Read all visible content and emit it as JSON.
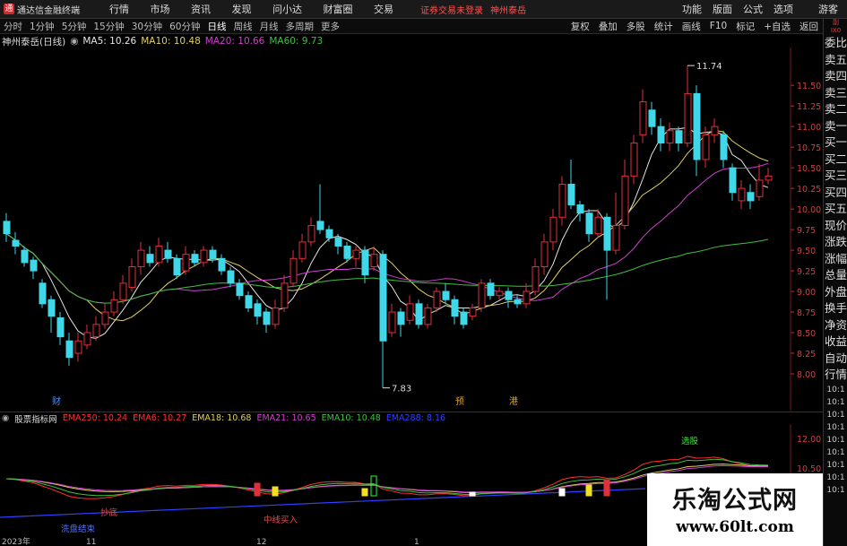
{
  "app": {
    "logo_char": "通",
    "title": "通达信金融终端"
  },
  "menu": [
    "行情",
    "市场",
    "资讯",
    "发现",
    "问小达",
    "财富圈",
    "交易"
  ],
  "notice": "证券交易未登录",
  "stock_tag": "神州泰岳",
  "top_right": [
    "功能",
    "版面",
    "公式",
    "选项"
  ],
  "guest": "游客",
  "periods": [
    "分时",
    "1分钟",
    "5分钟",
    "15分钟",
    "30分钟",
    "60分钟",
    "日线",
    "周线",
    "月线",
    "多周期",
    "更多"
  ],
  "active_period": "日线",
  "period_tools": [
    "复权",
    "叠加",
    "多股",
    "统计",
    "画线",
    "F10",
    "标记",
    "+自选",
    "返回"
  ],
  "stock_label": "神州泰岳(日线)",
  "ma": [
    {
      "label": "MA5: 10.26",
      "color": "#e6e6e6"
    },
    {
      "label": "MA10: 10.48",
      "color": "#e0d060"
    },
    {
      "label": "MA20: 10.66",
      "color": "#d040d0"
    },
    {
      "label": "MA60: 9.73",
      "color": "#40c040"
    }
  ],
  "right_panel": {
    "small": [
      "副",
      "IX0"
    ],
    "items": [
      "委比",
      "卖五",
      "卖四",
      "卖三",
      "卖二",
      "卖一",
      "买一",
      "买二",
      "买三",
      "买四",
      "买五",
      "现价",
      "涨跌",
      "涨幅",
      "总量",
      "外盘",
      "换手",
      "净资",
      "收益",
      "自动",
      "行情"
    ],
    "times": [
      "10:1",
      "10:1",
      "10:1",
      "10:1",
      "10:1",
      "10:1",
      "10:1",
      "10:1",
      "10:1"
    ]
  },
  "price_axis": [
    "11.50",
    "11.25",
    "11.00",
    "10.75",
    "10.50",
    "10.25",
    "10.00",
    "9.75",
    "9.50",
    "9.25",
    "9.00",
    "8.75",
    "8.50",
    "8.25",
    "8.00"
  ],
  "annotations": {
    "high": "11.74",
    "low": "7.83",
    "marker_cai": "财",
    "marker_yu": "预",
    "marker_gang": "港"
  },
  "indicator": {
    "name": "股票指标网",
    "items": [
      {
        "label": "EMA250: 10.24",
        "color": "#ff3030"
      },
      {
        "label": "EMA6: 10.27",
        "color": "#ff3030"
      },
      {
        "label": "EMA18: 10.68",
        "color": "#e0d060"
      },
      {
        "label": "EMA21: 10.65",
        "color": "#d040d0"
      },
      {
        "label": "EMA10: 10.48",
        "color": "#40c040"
      },
      {
        "label": "EMA288: 8.16",
        "color": "#3040ff"
      }
    ],
    "axis": [
      "12.00",
      "10.50"
    ],
    "labels": {
      "select": "选股",
      "bottom": "抄底",
      "mid_buy": "中线买入",
      "wash_end": "洗盘结束"
    }
  },
  "dates": [
    "2023年",
    "11",
    "12",
    "1"
  ],
  "watermark": {
    "title": "乐淘公式网",
    "url": "www.60lt.com"
  },
  "chart_data": {
    "type": "candlestick",
    "y_range": [
      7.75,
      11.85
    ],
    "candles": [
      [
        9.85,
        9.7,
        9.95,
        9.6
      ],
      [
        9.62,
        9.55,
        9.72,
        9.45
      ],
      [
        9.5,
        9.35,
        9.55,
        9.3
      ],
      [
        9.38,
        9.25,
        9.42,
        9.15
      ],
      [
        9.1,
        8.85,
        9.15,
        8.8
      ],
      [
        8.9,
        8.7,
        8.95,
        8.5
      ],
      [
        8.68,
        8.45,
        8.75,
        8.35
      ],
      [
        8.4,
        8.2,
        8.5,
        8.1
      ],
      [
        8.25,
        8.4,
        8.5,
        8.15
      ],
      [
        8.35,
        8.5,
        8.6,
        8.3
      ],
      [
        8.45,
        8.6,
        8.7,
        8.4
      ],
      [
        8.6,
        8.75,
        8.85,
        8.55
      ],
      [
        8.75,
        8.9,
        9.0,
        8.7
      ],
      [
        8.9,
        9.1,
        9.2,
        8.85
      ],
      [
        9.05,
        9.3,
        9.4,
        9.0
      ],
      [
        9.3,
        9.5,
        9.6,
        9.2
      ],
      [
        9.45,
        9.35,
        9.55,
        9.3
      ],
      [
        9.35,
        9.55,
        9.65,
        9.3
      ],
      [
        9.5,
        9.4,
        9.6,
        9.35
      ],
      [
        9.4,
        9.2,
        9.45,
        9.15
      ],
      [
        9.25,
        9.45,
        9.55,
        9.2
      ],
      [
        9.45,
        9.35,
        9.5,
        9.3
      ],
      [
        9.35,
        9.5,
        9.55,
        9.3
      ],
      [
        9.5,
        9.4,
        9.55,
        9.35
      ],
      [
        9.4,
        9.25,
        9.45,
        9.2
      ],
      [
        9.25,
        9.1,
        9.3,
        9.05
      ],
      [
        9.1,
        8.95,
        9.15,
        8.9
      ],
      [
        8.95,
        8.8,
        9.0,
        8.75
      ],
      [
        8.85,
        8.7,
        8.9,
        8.6
      ],
      [
        8.75,
        8.6,
        8.8,
        8.5
      ],
      [
        8.6,
        8.8,
        8.9,
        8.55
      ],
      [
        8.8,
        9.1,
        9.2,
        8.75
      ],
      [
        9.1,
        9.4,
        9.5,
        9.05
      ],
      [
        9.4,
        9.6,
        9.7,
        9.35
      ],
      [
        9.6,
        9.8,
        9.9,
        9.55
      ],
      [
        9.85,
        9.75,
        10.3,
        9.7
      ],
      [
        9.75,
        9.65,
        9.8,
        9.6
      ],
      [
        9.65,
        9.55,
        9.7,
        9.45
      ],
      [
        9.55,
        9.4,
        9.6,
        9.35
      ],
      [
        9.4,
        9.5,
        9.55,
        9.3
      ],
      [
        9.5,
        9.2,
        9.55,
        9.1
      ],
      [
        9.3,
        9.45,
        9.55,
        9.25
      ],
      [
        9.45,
        8.4,
        9.5,
        7.83
      ],
      [
        8.5,
        8.75,
        8.85,
        8.45
      ],
      [
        8.75,
        8.6,
        8.8,
        8.45
      ],
      [
        8.65,
        8.85,
        8.95,
        8.6
      ],
      [
        8.85,
        8.6,
        8.9,
        8.55
      ],
      [
        8.6,
        8.8,
        8.85,
        8.55
      ],
      [
        8.8,
        9.0,
        9.05,
        8.75
      ],
      [
        9.0,
        8.9,
        9.1,
        8.85
      ],
      [
        8.9,
        8.7,
        8.95,
        8.6
      ],
      [
        8.75,
        8.6,
        8.8,
        8.55
      ],
      [
        8.7,
        8.8,
        8.85,
        8.65
      ],
      [
        8.8,
        9.1,
        9.15,
        8.75
      ],
      [
        9.1,
        8.95,
        9.15,
        8.9
      ],
      [
        8.95,
        9.0,
        9.05,
        8.9
      ],
      [
        9.0,
        8.9,
        9.05,
        8.8
      ],
      [
        8.9,
        8.85,
        8.95,
        8.8
      ],
      [
        8.85,
        9.0,
        9.1,
        8.8
      ],
      [
        9.0,
        9.3,
        9.4,
        8.95
      ],
      [
        9.3,
        9.6,
        9.7,
        9.2
      ],
      [
        9.6,
        9.9,
        10.0,
        9.5
      ],
      [
        9.9,
        10.3,
        10.4,
        9.8
      ],
      [
        10.3,
        10.05,
        10.6,
        10.0
      ],
      [
        10.05,
        9.95,
        10.1,
        9.85
      ],
      [
        9.95,
        9.7,
        10.0,
        9.6
      ],
      [
        9.7,
        9.9,
        10.0,
        9.65
      ],
      [
        9.9,
        9.5,
        9.95,
        8.9
      ],
      [
        9.5,
        9.8,
        10.2,
        9.45
      ],
      [
        9.8,
        10.4,
        10.6,
        9.75
      ],
      [
        10.4,
        10.8,
        10.9,
        10.3
      ],
      [
        10.9,
        11.3,
        11.45,
        10.8
      ],
      [
        11.2,
        11.0,
        11.3,
        10.9
      ],
      [
        11.0,
        10.8,
        11.1,
        10.7
      ],
      [
        10.8,
        10.95,
        11.05,
        10.7
      ],
      [
        10.95,
        10.8,
        11.0,
        10.7
      ],
      [
        10.8,
        11.4,
        11.74,
        10.75
      ],
      [
        11.4,
        10.6,
        11.5,
        10.4
      ],
      [
        10.6,
        10.9,
        11.0,
        10.5
      ],
      [
        10.9,
        11.0,
        11.1,
        10.8
      ],
      [
        10.9,
        10.6,
        10.95,
        10.5
      ],
      [
        10.5,
        10.2,
        10.55,
        10.1
      ],
      [
        10.1,
        10.25,
        10.35,
        10.0
      ],
      [
        10.2,
        10.1,
        10.3,
        10.0
      ],
      [
        10.15,
        10.35,
        10.55,
        10.1
      ],
      [
        10.35,
        10.4,
        10.5,
        10.3
      ]
    ]
  }
}
